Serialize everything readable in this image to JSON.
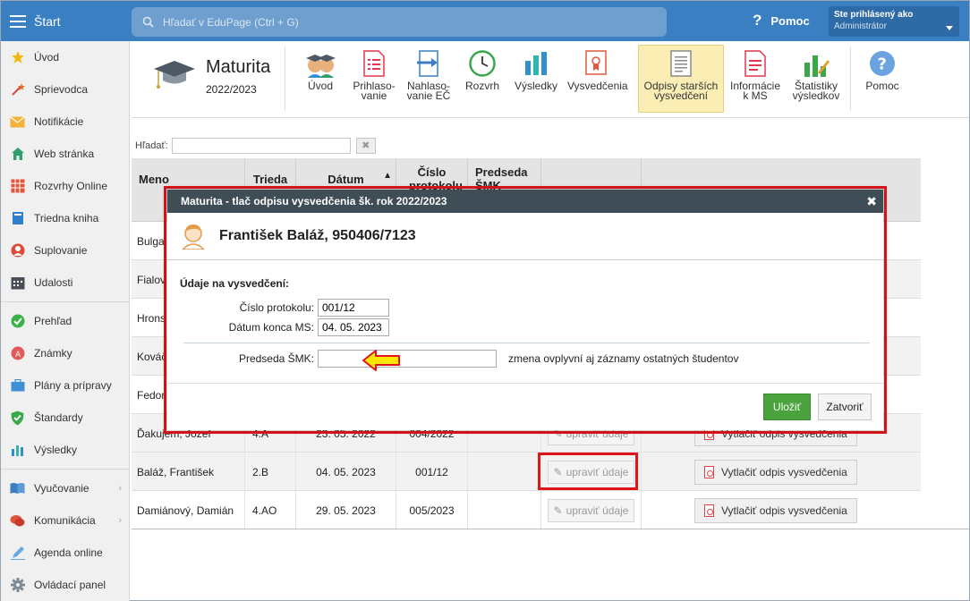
{
  "topbar": {
    "start_label": "Štart",
    "search_placeholder": "Hľadať v EduPage (Ctrl + G)",
    "help_label": "Pomoc",
    "user_line1": "Ste prihlásený ako",
    "user_line2": "Administrátor"
  },
  "sidebar": {
    "items": [
      {
        "label": "Úvod",
        "icon": "star-icon"
      },
      {
        "label": "Sprievodca",
        "icon": "wand-icon"
      },
      {
        "label": "Notifikácie",
        "icon": "envelope-icon"
      },
      {
        "label": "Web stránka",
        "icon": "house-icon"
      },
      {
        "label": "Rozvrhy Online",
        "icon": "calendar-grid-icon"
      },
      {
        "label": "Triedna kniha",
        "icon": "book-icon"
      },
      {
        "label": "Suplovanie",
        "icon": "person-icon"
      },
      {
        "label": "Udalosti",
        "icon": "calendar-icon"
      },
      {
        "label": "Prehľad",
        "icon": "check-circle-icon"
      },
      {
        "label": "Známky",
        "icon": "grade-icon"
      },
      {
        "label": "Plány a prípravy",
        "icon": "briefcase-icon"
      },
      {
        "label": "Štandardy",
        "icon": "shield-check-icon"
      },
      {
        "label": "Výsledky",
        "icon": "bar-chart-icon"
      },
      {
        "label": "Vyučovanie",
        "icon": "open-book-icon"
      },
      {
        "label": "Komunikácia",
        "icon": "chat-icon"
      },
      {
        "label": "Agenda online",
        "icon": "pen-icon"
      },
      {
        "label": "Ovládací panel",
        "icon": "gear-icon"
      }
    ]
  },
  "module": {
    "title": "Maturita",
    "year": "2022/2023",
    "tools": [
      {
        "line1": "Úvod",
        "line2": ""
      },
      {
        "line1": "Prihlaso-",
        "line2": "vanie"
      },
      {
        "line1": "Nahlaso-",
        "line2": "vanie EČ"
      },
      {
        "line1": "Rozvrh",
        "line2": ""
      },
      {
        "line1": "Výsledky",
        "line2": ""
      },
      {
        "line1": "Vysvedčenia",
        "line2": ""
      },
      {
        "line1": "Odpisy starších",
        "line2": "vysvedčení"
      },
      {
        "line1": "Informácie",
        "line2": "k MS"
      },
      {
        "line1": "Štatistiky",
        "line2": "výsledkov"
      },
      {
        "line1": "Pomoc",
        "line2": ""
      }
    ]
  },
  "filter": {
    "label": "Hľadať:",
    "clear": "✖"
  },
  "table": {
    "headers": {
      "name": "Meno",
      "class": "Trieda",
      "date": "Dátum",
      "sort": "▲",
      "protocol": "Číslo protokolu",
      "chair": "Predseda ŠMK"
    },
    "edit_label": "upraviť údaje",
    "print_label": "Vytlačiť odpis vysvedčenia",
    "rows": [
      {
        "name": "Bulga",
        "class": "",
        "date": "",
        "protocol": ""
      },
      {
        "name": "Fialov",
        "class": "",
        "date": "",
        "protocol": ""
      },
      {
        "name": "Hrons",
        "class": "",
        "date": "",
        "protocol": ""
      },
      {
        "name": "Kováč",
        "class": "",
        "date": "",
        "protocol": ""
      },
      {
        "name": "Fedor",
        "class": "",
        "date": "",
        "protocol": ""
      },
      {
        "name": "Ďakujem, Jozef",
        "class": "4.A",
        "date": "23. 05. 2022",
        "protocol": "004/2022"
      },
      {
        "name": "Baláž, František",
        "class": "2.B",
        "date": "04. 05. 2023",
        "protocol": "001/12"
      },
      {
        "name": "Damiánový, Damián",
        "class": "4.AO",
        "date": "29. 05. 2023",
        "protocol": "005/2023"
      }
    ]
  },
  "modal": {
    "title": "Maturita - tlač odpisu vysvedčenia šk. rok 2022/2023",
    "close": "✖",
    "person": "František Baláž, 950406/7123",
    "section": "Údaje na vysvedčení:",
    "protocol_label": "Číslo protokolu:",
    "protocol_value": "001/12",
    "date_label": "Dátum konca MS:",
    "date_value": "04. 05. 2023",
    "chair_label": "Predseda ŠMK:",
    "chair_value": "",
    "note": "zmena ovplyvní aj záznamy ostatných študentov",
    "save": "Uložiť",
    "cancel": "Zatvoriť"
  },
  "colors": {
    "topbar": "#3a7fc1",
    "highlight": "#e0141b",
    "save": "#4aa33d",
    "active_tool": "#fbeeb5",
    "arrow": "#ffe600"
  }
}
